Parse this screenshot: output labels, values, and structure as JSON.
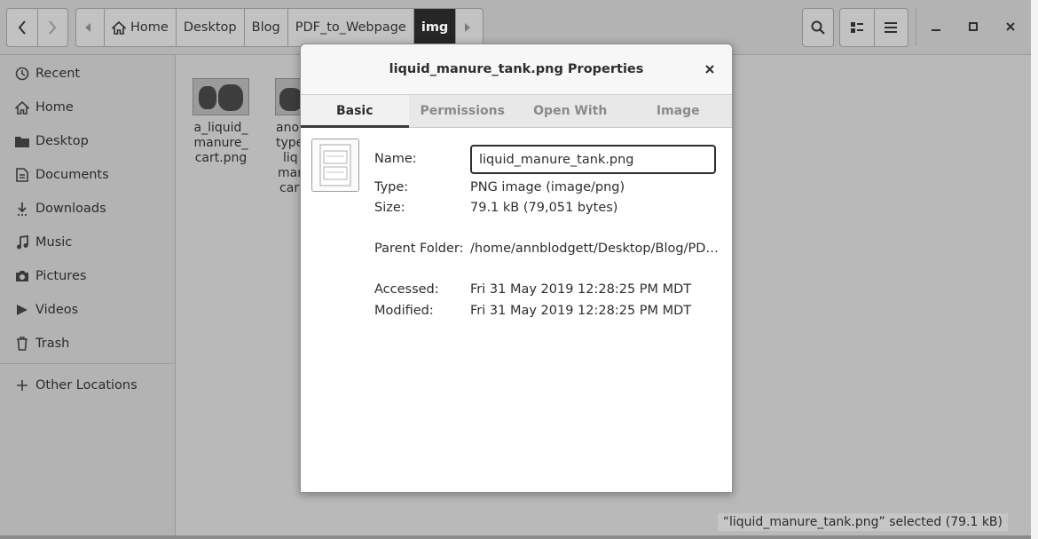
{
  "window": {
    "nav": {
      "back_icon": "chevron-left-icon",
      "forward_icon": "chevron-right-icon"
    },
    "pathbar": {
      "segments": [
        "Home",
        "Desktop",
        "Blog",
        "PDF_to_Webpage",
        "img"
      ],
      "active": "img"
    },
    "sidebar": {
      "items": [
        {
          "label": "Recent",
          "icon": "clock-icon"
        },
        {
          "label": "Home",
          "icon": "home-icon"
        },
        {
          "label": "Desktop",
          "icon": "folder-icon"
        },
        {
          "label": "Documents",
          "icon": "document-icon"
        },
        {
          "label": "Downloads",
          "icon": "download-icon"
        },
        {
          "label": "Music",
          "icon": "music-icon"
        },
        {
          "label": "Pictures",
          "icon": "camera-icon"
        },
        {
          "label": "Videos",
          "icon": "video-icon"
        },
        {
          "label": "Trash",
          "icon": "trash-icon"
        }
      ],
      "other_locations": "Other Locations"
    },
    "files": [
      {
        "lines": [
          "a_liquid_",
          "manure_",
          "cart.png"
        ]
      },
      {
        "lines": [
          "ano",
          "type",
          "liq",
          "mar",
          "cart"
        ]
      }
    ],
    "status": "“liquid_manure_tank.png” selected  (79.1 kB)"
  },
  "dialog": {
    "title": "liquid_manure_tank.png Properties",
    "tabs": [
      "Basic",
      "Permissions",
      "Open With",
      "Image"
    ],
    "active_tab": "Basic",
    "name_label": "Name:",
    "name_value": "liquid_manure_tank.png",
    "type_label": "Type:",
    "type_value": "PNG image (image/png)",
    "size_label": "Size:",
    "size_value": "79.1 kB (79,051 bytes)",
    "parent_label": "Parent Folder:",
    "parent_value": "/home/annblodgett/Desktop/Blog/PD…",
    "accessed_label": "Accessed:",
    "accessed_value": "Fri 31 May 2019 12:28:25 PM MDT",
    "modified_label": "Modified:",
    "modified_value": "Fri 31 May 2019 12:28:25 PM MDT"
  },
  "colors": {
    "overlay": "#b9b9b9",
    "dialog_bg": "#ffffff",
    "active_path": "#262626"
  }
}
